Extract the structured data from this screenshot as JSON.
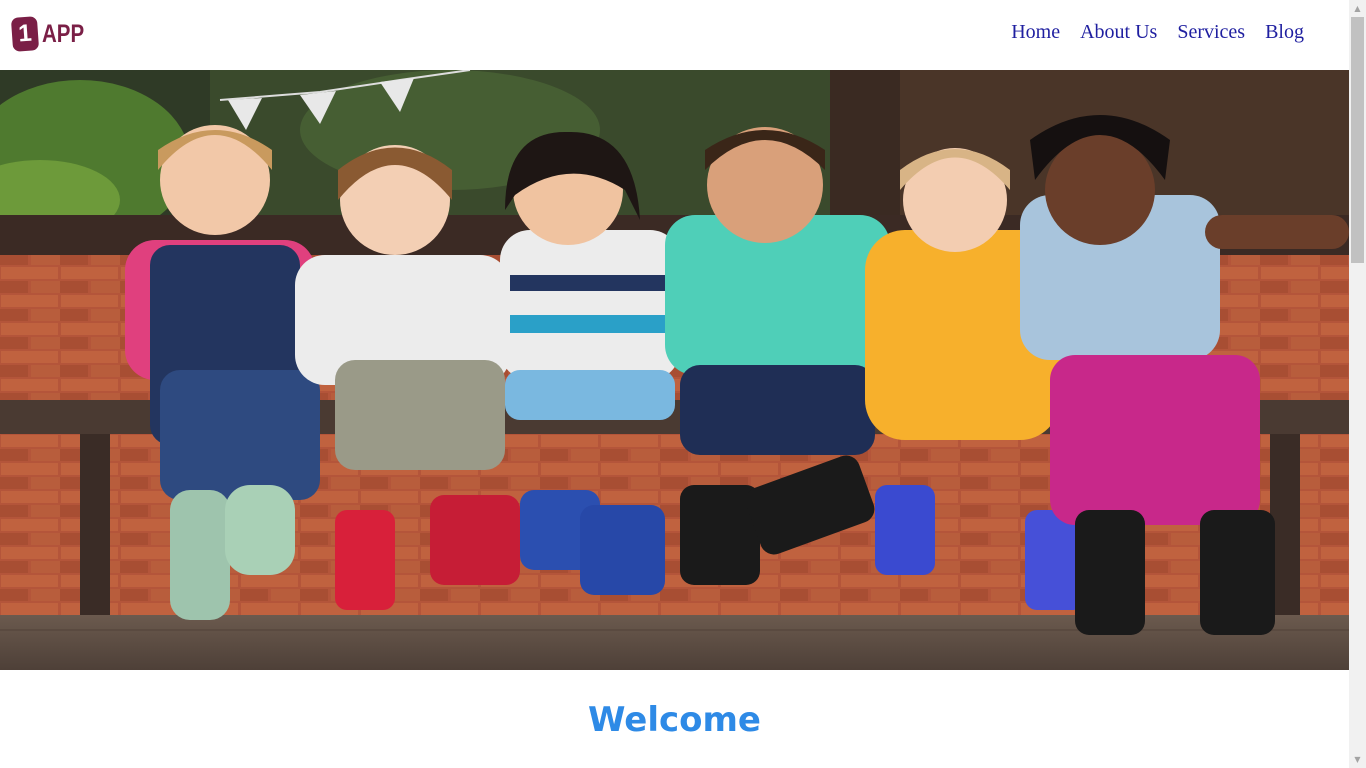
{
  "header": {
    "logo": {
      "mark": "1",
      "text": "APP",
      "color": "#7a1f46"
    },
    "nav": [
      {
        "label": "Home"
      },
      {
        "label": "About Us"
      },
      {
        "label": "Services"
      },
      {
        "label": "Blog"
      }
    ],
    "nav_color": "#1f1fa0"
  },
  "hero": {
    "image": "photo-children-sitting-on-bench",
    "colors": {
      "wall": "#b4553a",
      "bench": "#4a3a32",
      "deck": "#6b5a4e",
      "foliage": "#3d5a2a"
    }
  },
  "main": {
    "heading": "Welcome",
    "heading_color": "#2e8ae6"
  },
  "scrollbar": {
    "up_icon": "▲",
    "down_icon": "▼"
  }
}
